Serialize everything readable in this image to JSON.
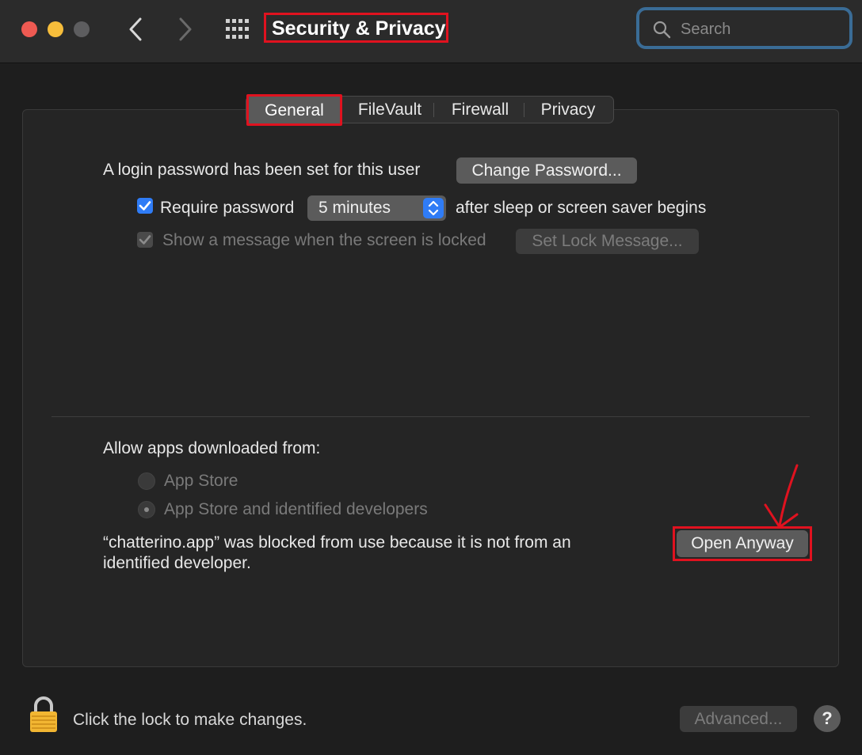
{
  "window": {
    "title": "Security & Privacy"
  },
  "search": {
    "placeholder": "Search"
  },
  "tabs": [
    {
      "label": "General",
      "selected": true
    },
    {
      "label": "FileVault",
      "selected": false
    },
    {
      "label": "Firewall",
      "selected": false
    },
    {
      "label": "Privacy",
      "selected": false
    }
  ],
  "general": {
    "login_text": "A login password has been set for this user",
    "change_password_label": "Change Password...",
    "require_password_label": "Require password",
    "require_password_checked": true,
    "require_password_delay": "5 minutes",
    "after_sleep_text": "after sleep or screen saver begins",
    "show_message_label": "Show a message when the screen is locked",
    "show_message_checked": true,
    "set_lock_message_label": "Set Lock Message..."
  },
  "allow_apps": {
    "heading": "Allow apps downloaded from:",
    "options": [
      {
        "label": "App Store",
        "selected": false
      },
      {
        "label": "App Store and identified developers",
        "selected": true
      }
    ],
    "blocked_line1": "“chatterino.app” was blocked from use because it is not from an",
    "blocked_line2": "identified developer.",
    "open_anyway_label": "Open Anyway"
  },
  "footer": {
    "lock_text": "Click the lock to make changes.",
    "advanced_label": "Advanced...",
    "help_label": "?"
  },
  "colors": {
    "accent": "#2f7cf6",
    "highlight": "#e0121f",
    "close": "#ee5a52",
    "minimize": "#f6bd3b",
    "lock": "#f2b632"
  },
  "icons": [
    "chevron-left-icon",
    "chevron-right-icon",
    "grid-icon",
    "search-icon",
    "checkmark-icon",
    "updown-arrows-icon",
    "lock-icon",
    "annotation-arrow-icon"
  ]
}
